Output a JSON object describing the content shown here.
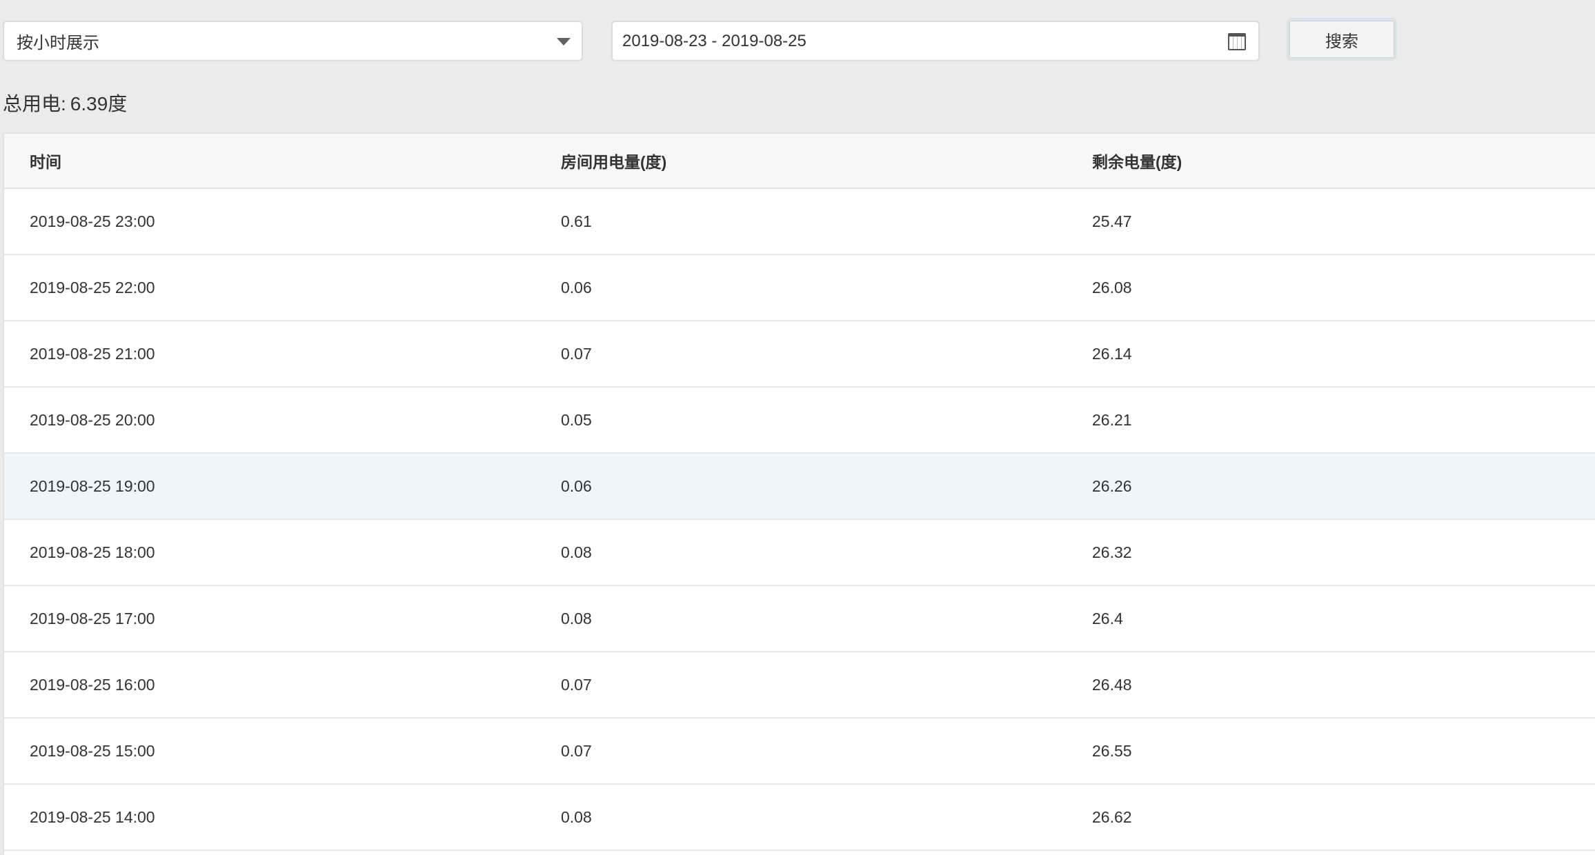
{
  "toolbar": {
    "mode_select": {
      "value": "按小时展示"
    },
    "date_range": {
      "value": "2019-08-23 - 2019-08-25"
    },
    "search_label": "搜索"
  },
  "summary": {
    "label": "总用电:",
    "value": "6.39度"
  },
  "table": {
    "headers": [
      "时间",
      "房间用电量(度)",
      "剩余电量(度)"
    ],
    "rows": [
      {
        "time": "2019-08-25 23:00",
        "usage": "0.61",
        "remaining": "25.47"
      },
      {
        "time": "2019-08-25 22:00",
        "usage": "0.06",
        "remaining": "26.08"
      },
      {
        "time": "2019-08-25 21:00",
        "usage": "0.07",
        "remaining": "26.14"
      },
      {
        "time": "2019-08-25 20:00",
        "usage": "0.05",
        "remaining": "26.21"
      },
      {
        "time": "2019-08-25 19:00",
        "usage": "0.06",
        "remaining": "26.26"
      },
      {
        "time": "2019-08-25 18:00",
        "usage": "0.08",
        "remaining": "26.32"
      },
      {
        "time": "2019-08-25 17:00",
        "usage": "0.08",
        "remaining": "26.4"
      },
      {
        "time": "2019-08-25 16:00",
        "usage": "0.07",
        "remaining": "26.48"
      },
      {
        "time": "2019-08-25 15:00",
        "usage": "0.07",
        "remaining": "26.55"
      },
      {
        "time": "2019-08-25 14:00",
        "usage": "0.08",
        "remaining": "26.62"
      }
    ],
    "highlighted_row": 4
  },
  "colors": {
    "background": "#ebebeb",
    "row_highlight": "#ecf6fc",
    "header_bg": "#f7f7f7"
  },
  "icons": {
    "select_caret": "chevron-down-icon",
    "date_picker": "calendar-icon"
  }
}
